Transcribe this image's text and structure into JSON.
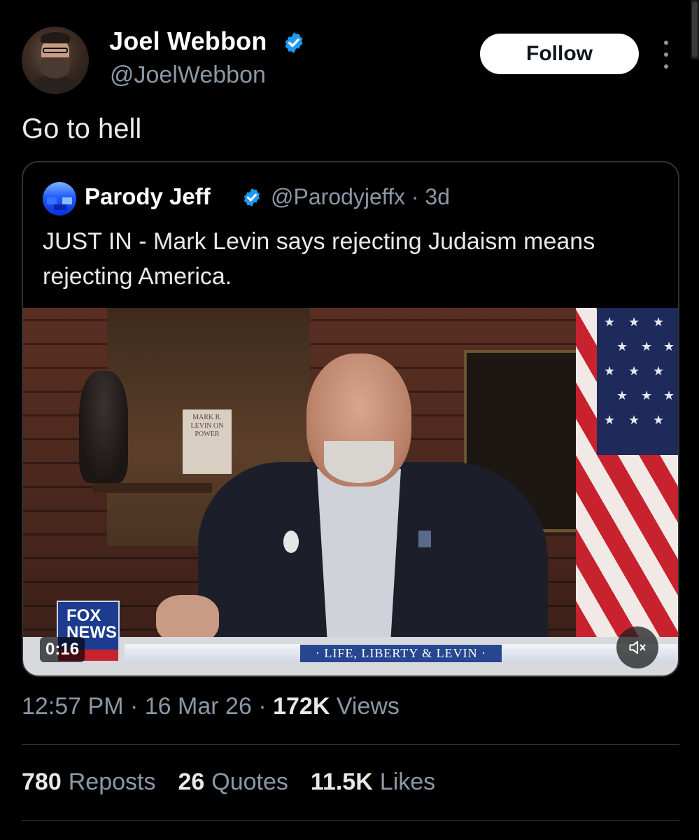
{
  "author": {
    "display_name": "Joel Webbon",
    "handle": "@JoelWebbon",
    "verified": true
  },
  "follow_label": "Follow",
  "tweet_text": "Go to hell",
  "quoted": {
    "display_name": "Parody Jeff",
    "handle": "@Parodyjeffx",
    "separator": "·",
    "age": "3d",
    "text": "JUST IN - Mark Levin says rejecting Judaism means rejecting America.",
    "video": {
      "time_remaining": "0:16",
      "lower_third": "· LIFE, LIBERTY & LEVIN ·",
      "channel_logo_top": "FOX",
      "channel_logo_bottom": "NEWS",
      "book_title": "MARK R. LEVIN ON POWER",
      "muted": true
    }
  },
  "meta": {
    "time": "12:57 PM",
    "date": "16 Mar 26",
    "views_count": "172K",
    "views_label": "Views",
    "separator": "·"
  },
  "stats": [
    {
      "count": "780",
      "label": "Reposts"
    },
    {
      "count": "26",
      "label": "Quotes"
    },
    {
      "count": "11.5K",
      "label": "Likes"
    }
  ],
  "colors": {
    "background": "#000000",
    "primary_text": "#e7e9ea",
    "secondary_text": "#8b98a5",
    "verified_blue": "#1d9bf0",
    "border": "#2f3336"
  },
  "icons": [
    "verified-badge-icon",
    "more-options-icon",
    "mute-icon"
  ]
}
